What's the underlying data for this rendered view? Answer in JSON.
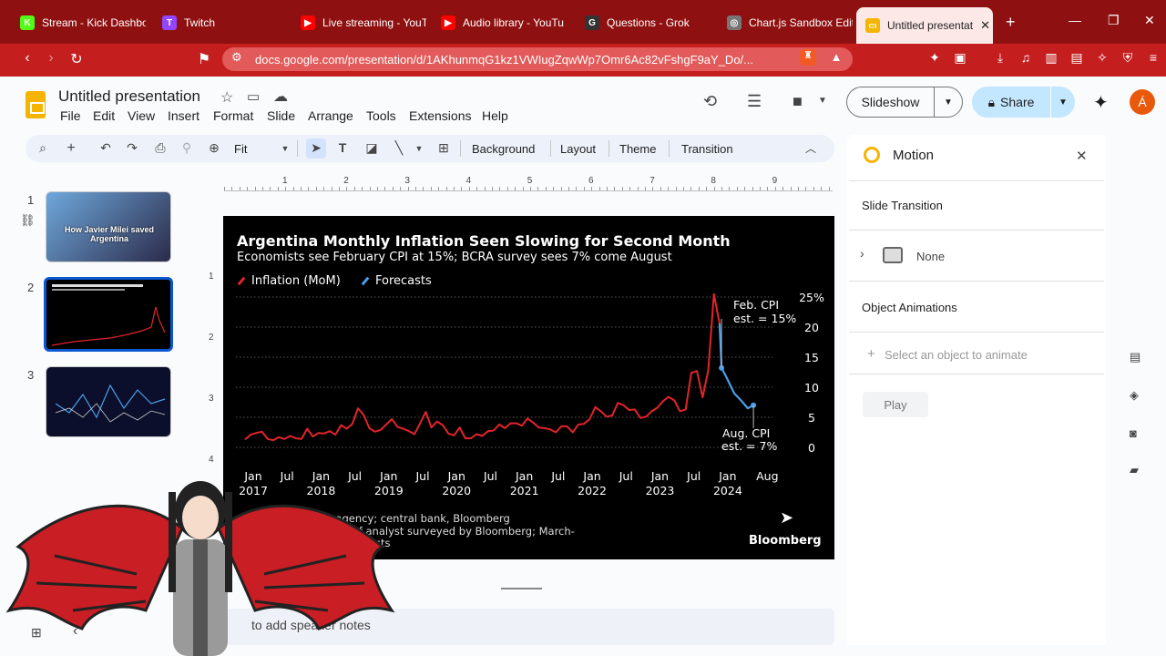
{
  "browser": {
    "tabs": [
      {
        "title": "Stream - Kick Dashbo",
        "icon_color": "#53fc18",
        "glyph": "K"
      },
      {
        "title": "Twitch",
        "icon_color": "#9146ff",
        "glyph": "T"
      },
      {
        "title": "Live streaming - YouT",
        "icon_color": "#ff0000",
        "glyph": "▶"
      },
      {
        "title": "Audio library - YouTu",
        "icon_color": "#ff0000",
        "glyph": "▶"
      },
      {
        "title": "Questions - Grok",
        "icon_color": "#333333",
        "glyph": "G"
      },
      {
        "title": "Chart.js Sandbox Edit",
        "icon_color": "#777777",
        "glyph": "◎"
      },
      {
        "title": "Untitled presentat",
        "icon_color": "#f4b400",
        "glyph": "▭",
        "active": true
      }
    ],
    "url": "docs.google.com/presentation/d/1AKhunmqG1kz1VWIugZqwWp7Omr6Ac82vFshgF9aY_Do/..."
  },
  "app": {
    "title": "Untitled presentation",
    "menu": [
      "File",
      "Edit",
      "View",
      "Insert",
      "Format",
      "Slide",
      "Arrange",
      "Tools",
      "Extensions",
      "Help"
    ],
    "slideshow_label": "Slideshow",
    "share_label": "Share",
    "avatar_letter": "Á",
    "toolbar": {
      "zoom": "Fit",
      "background": "Background",
      "layout": "Layout",
      "theme": "Theme",
      "transition": "Transition"
    },
    "notes_placeholder": "to add speaker notes"
  },
  "filmstrip": {
    "slides": [
      {
        "num": "1",
        "caption": "How Javier Milei saved Argentina"
      },
      {
        "num": "2",
        "caption": ""
      },
      {
        "num": "3",
        "caption": ""
      }
    ]
  },
  "ruler": {
    "labels": [
      "1",
      "2",
      "3",
      "4",
      "5",
      "6",
      "7",
      "8",
      "9"
    ],
    "vlabels": [
      "1",
      "2",
      "3",
      "4"
    ]
  },
  "slide": {
    "source_line1": "Sou          onal statistics agency; central bank, Bloomberg",
    "source_line2": "N          data = median est. of analyst surveyed by Bloomberg; March-",
    "source_line3": "               n BCRA survey of economists",
    "brand": "Bloomberg"
  },
  "chart_data": {
    "type": "line",
    "title": "Argentina Monthly Inflation Seen Slowing for Second Month",
    "subtitle": "Economists see February CPI at 15%; BCRA survey sees 7% come August",
    "legend_position": "top-left",
    "grid": true,
    "ylim": [
      0,
      25
    ],
    "y_ticks": [
      "25%",
      "20",
      "15",
      "10",
      "5",
      "0"
    ],
    "x_ticks": [
      {
        "label": "Jan",
        "year": "2017"
      },
      {
        "label": "Jul",
        "year": ""
      },
      {
        "label": "Jan",
        "year": "2018"
      },
      {
        "label": "Jul",
        "year": ""
      },
      {
        "label": "Jan",
        "year": "2019"
      },
      {
        "label": "Jul",
        "year": ""
      },
      {
        "label": "Jan",
        "year": "2020"
      },
      {
        "label": "Jul",
        "year": ""
      },
      {
        "label": "Jan",
        "year": "2021"
      },
      {
        "label": "Jul",
        "year": ""
      },
      {
        "label": "Jan",
        "year": "2022"
      },
      {
        "label": "Jul",
        "year": ""
      },
      {
        "label": "Jan",
        "year": "2023"
      },
      {
        "label": "Jul",
        "year": ""
      },
      {
        "label": "Jan",
        "year": "2024"
      },
      {
        "label": "Aug",
        "year": ""
      }
    ],
    "series": [
      {
        "name": "Inflation (MoM)",
        "color": "#e3242b",
        "values": [
          1.3,
          2.1,
          2.4,
          2.6,
          1.4,
          1.2,
          1.7,
          1.4,
          1.9,
          1.5,
          1.4,
          3.1,
          1.8,
          2.4,
          2.3,
          2.7,
          2.1,
          3.7,
          3.1,
          3.9,
          6.5,
          5.4,
          3.2,
          2.6,
          2.9,
          3.8,
          4.7,
          3.4,
          3.1,
          2.7,
          2.2,
          4.0,
          5.9,
          3.3,
          4.3,
          3.7,
          2.3,
          2.0,
          3.3,
          1.5,
          1.5,
          2.2,
          1.9,
          2.7,
          2.8,
          3.8,
          3.2,
          4.0,
          4.0,
          3.6,
          4.8,
          4.1,
          3.3,
          3.2,
          3.0,
          2.5,
          3.5,
          3.5,
          2.5,
          3.8,
          3.9,
          4.7,
          6.7,
          6.0,
          5.1,
          5.3,
          7.4,
          7.0,
          6.2,
          6.3,
          4.9,
          5.1,
          6.0,
          6.6,
          7.7,
          8.4,
          7.8,
          6.0,
          6.3,
          12.4,
          12.7,
          8.3,
          12.8,
          25.5,
          20.6
        ]
      },
      {
        "name": "Forecasts",
        "color": "#4a9eea",
        "values": [
          20.6,
          13.2,
          11.5,
          9.0,
          7.8,
          6.5,
          7.0
        ]
      }
    ],
    "annotations": [
      {
        "text1": "Feb. CPI",
        "text2": "est. = 15%"
      },
      {
        "text1": "Aug. CPI",
        "text2": "est. = 7%"
      }
    ]
  },
  "panel": {
    "title": "Motion",
    "slide_transition": "Slide Transition",
    "transition_value": "None",
    "object_animations": "Object Animations",
    "select_prompt": "Select an object to animate",
    "play": "Play"
  }
}
